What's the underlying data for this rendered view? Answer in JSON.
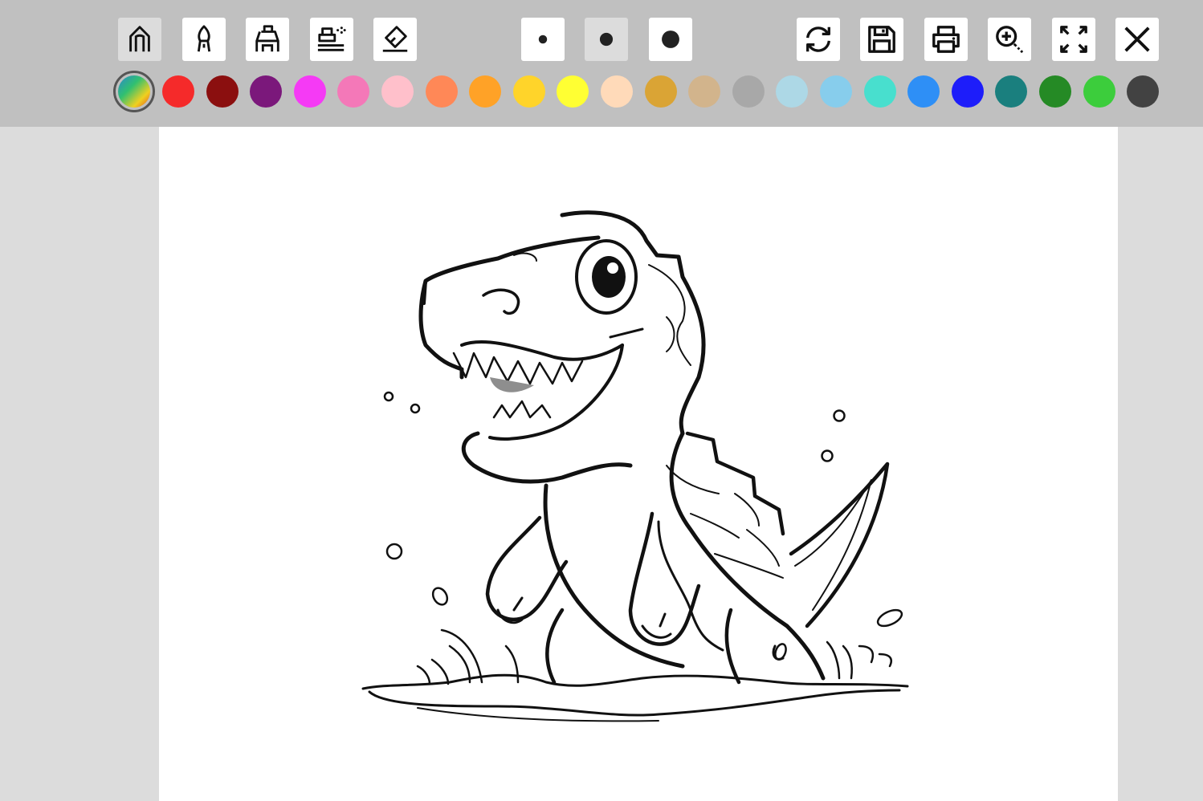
{
  "toolbar": {
    "drawing_tools": [
      {
        "icon": "pencil-icon",
        "active": true
      },
      {
        "icon": "brush-icon",
        "active": false
      },
      {
        "icon": "marker-icon",
        "active": false
      },
      {
        "icon": "spray-icon",
        "active": false
      },
      {
        "icon": "eraser-icon",
        "active": false
      }
    ],
    "brush_sizes": [
      {
        "icon": "small-dot-icon",
        "active": false
      },
      {
        "icon": "medium-dot-icon",
        "active": true
      },
      {
        "icon": "large-dot-icon",
        "active": false
      }
    ],
    "actions": [
      "refresh-icon",
      "save-icon",
      "print-icon",
      "zoom-in-icon",
      "fullscreen-icon",
      "close-icon"
    ]
  },
  "palette": {
    "selected": "rainbow",
    "colors": [
      "rainbow",
      "#f52a2a",
      "#8b0f0f",
      "#7b187b",
      "#f53af5",
      "#f478b8",
      "#ffc0cb",
      "#ff8857",
      "#ffa227",
      "#ffd42a",
      "#ffff33",
      "#ffdab9",
      "#daa435",
      "#d2b48c",
      "#a8a8a8",
      "#add8e6",
      "#87cdec",
      "#48dfce",
      "#2e8ff6",
      "#1d1dfa",
      "#1a7f7e",
      "#258a25",
      "#3ccd3c",
      "#424242"
    ]
  },
  "canvas": {
    "picture": "dinosaur-coloring-page"
  }
}
